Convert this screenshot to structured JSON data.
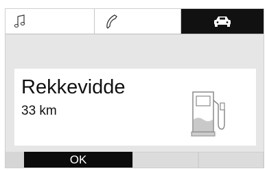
{
  "tabs": [
    {
      "icon": "music-note-icon",
      "active": false
    },
    {
      "icon": "phone-icon",
      "active": false
    },
    {
      "icon": "car-icon",
      "active": true
    }
  ],
  "info": {
    "title": "Rekkevidde",
    "value": "33 km",
    "icon": "fuel-pump-icon"
  },
  "softkeys": {
    "ok_label": "OK"
  },
  "colors": {
    "active_tab": "#111111",
    "background": "#e6e6e6",
    "panel": "#ffffff",
    "fuel_fill": "#c9c9c9"
  }
}
